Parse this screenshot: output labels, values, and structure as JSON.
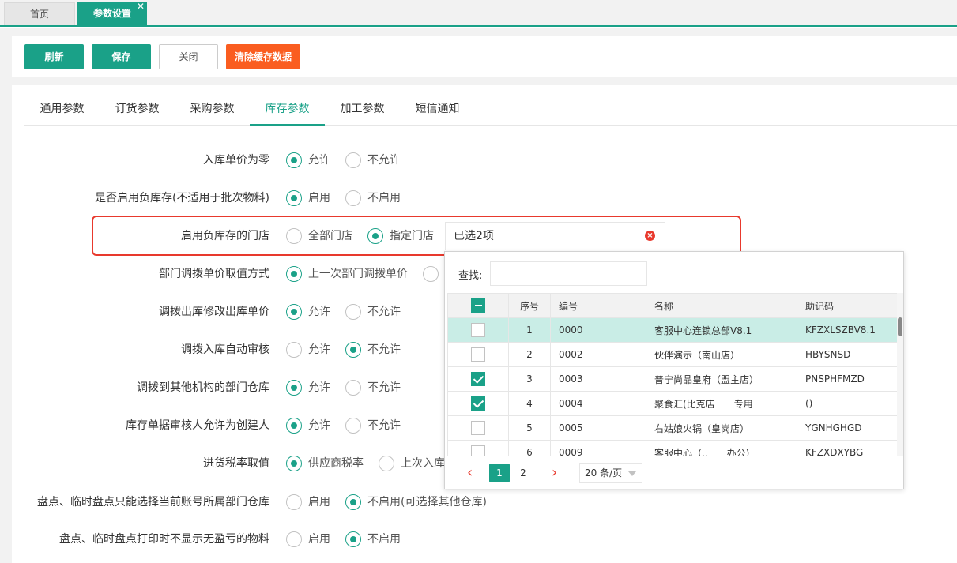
{
  "top_tabs": {
    "home": "首页",
    "params": "参数设置",
    "close": "✕"
  },
  "toolbar": {
    "refresh": "刷新",
    "save": "保存",
    "close": "关闭",
    "clear_cache": "清除缓存数据"
  },
  "sub_tabs": [
    "通用参数",
    "订货参数",
    "采购参数",
    "库存参数",
    "加工参数",
    "短信通知"
  ],
  "active_sub_tab": "库存参数",
  "rows": {
    "r1": {
      "label": "入库单价为零",
      "opt1": "允许",
      "opt2": "不允许",
      "selected": 1
    },
    "r2": {
      "label": "是否启用负库存(不适用于批次物料)",
      "opt1": "启用",
      "opt2": "不启用",
      "selected": 1
    },
    "r3": {
      "label": "启用负库存的门店",
      "opt1": "全部门店",
      "opt2": "指定门店",
      "selected": 2,
      "input_value": "已选2项"
    },
    "r4": {
      "label": "部门调拨单价取值方式",
      "opt1": "上一次部门调拨单价",
      "selected": 1
    },
    "r5": {
      "label": "调拨出库修改出库单价",
      "opt1": "允许",
      "opt2": "不允许",
      "selected": 1
    },
    "r6": {
      "label": "调拨入库自动审核",
      "opt1": "允许",
      "opt2": "不允许",
      "selected": 2
    },
    "r7": {
      "label": "调拨到其他机构的部门仓库",
      "opt1": "允许",
      "opt2": "不允许",
      "selected": 1
    },
    "r8": {
      "label": "库存单据审核人允许为创建人",
      "opt1": "允许",
      "opt2": "不允许",
      "selected": 1
    },
    "r9": {
      "label": "进货税率取值",
      "opt1": "供应商税率",
      "opt2": "上次入库",
      "selected": 1
    },
    "r10": {
      "label": "盘点、临时盘点只能选择当前账号所属部门仓库",
      "opt1": "启用",
      "opt2": "不启用(可选择其他仓库)",
      "selected": 2
    },
    "r11": {
      "label": "盘点、临时盘点打印时不显示无盈亏的物料",
      "opt1": "启用",
      "opt2": "不启用",
      "selected": 2
    }
  },
  "store_picker": {
    "search_label": "查找:",
    "search_value": "",
    "columns": [
      "序号",
      "编号",
      "名称",
      "助记码"
    ],
    "rows": [
      {
        "seq": "1",
        "code": "0000",
        "name": "客服中心连锁总部V8.1",
        "mnemonic": "KFZXLSZBV8.1",
        "checked": false,
        "highlighted": true
      },
      {
        "seq": "2",
        "code": "0002",
        "name": "伙伴演示（南山店）",
        "mnemonic": "HBYSNSD",
        "checked": false,
        "highlighted": false
      },
      {
        "seq": "3",
        "code": "0003",
        "name": "普宁尚品皇府（盟主店）",
        "mnemonic": "PNSPHFMZD",
        "checked": true,
        "highlighted": false
      },
      {
        "seq": "4",
        "code": "0004",
        "name": "聚食汇(比克店　　专用",
        "mnemonic": "()",
        "checked": true,
        "highlighted": false
      },
      {
        "seq": "5",
        "code": "0005",
        "name": "右姑娘火锅（皇岗店）",
        "mnemonic": "YGNHGHGD",
        "checked": false,
        "highlighted": false
      },
      {
        "seq": "6",
        "code": "0009",
        "name": "客服中心（..　　办公)",
        "mnemonic": "KFZXDXYBG",
        "checked": false,
        "highlighted": false
      }
    ],
    "pagination": {
      "prev": "‹",
      "current": "1",
      "page2": "2",
      "next": "›",
      "page_size": "20 条/页"
    }
  },
  "colors": {
    "accent": "#1aa188",
    "danger": "#e8392d",
    "orange": "#fa5d20"
  }
}
